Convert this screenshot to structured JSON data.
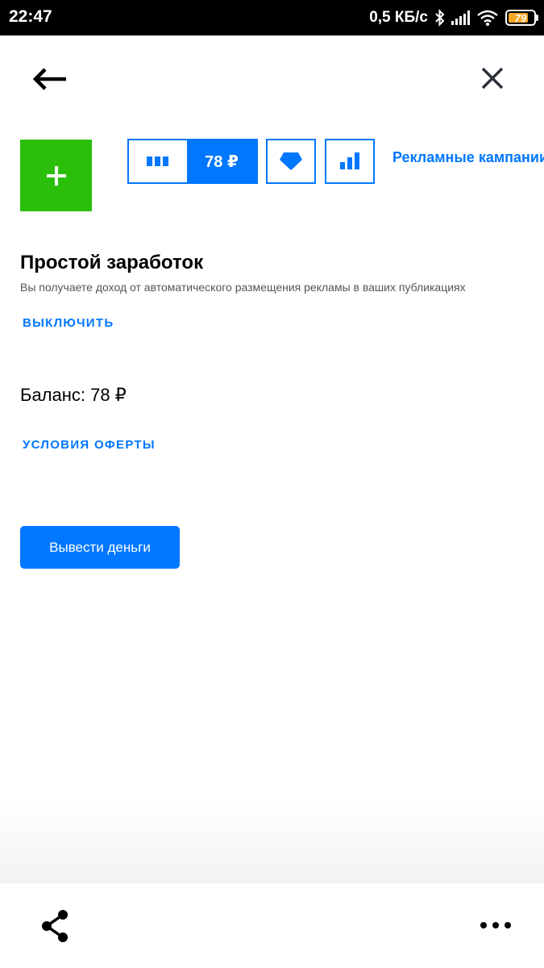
{
  "status_bar": {
    "time": "22:47",
    "network_speed": "0,5 КБ/с",
    "battery_level": "79",
    "icons": [
      "bluetooth-icon",
      "signal-icon",
      "wifi-icon",
      "battery-icon"
    ]
  },
  "header": {
    "back_icon": "arrow-left-icon",
    "close_icon": "close-icon"
  },
  "toolbar": {
    "add_icon": "plus-icon",
    "balance_chip": "78 ₽",
    "ad_campaigns_label": "Рекламные кампании"
  },
  "content": {
    "title": "Простой заработок",
    "description": "Вы получаете доход от автоматического размещения рекламы в ваших публикациях",
    "disable_label": "ВЫКЛЮЧИТЬ",
    "balance_text": "Баланс: 78 ₽",
    "offer_terms_label": "УСЛОВИЯ ОФЕРТЫ",
    "withdraw_label": "Вывести деньги"
  },
  "bottom_bar": {
    "share_icon": "share-icon",
    "more_icon": "more-horizontal-icon"
  },
  "colors": {
    "accent": "#0077ff",
    "add_button": "#2bbf0c",
    "battery": "#f5a623"
  }
}
